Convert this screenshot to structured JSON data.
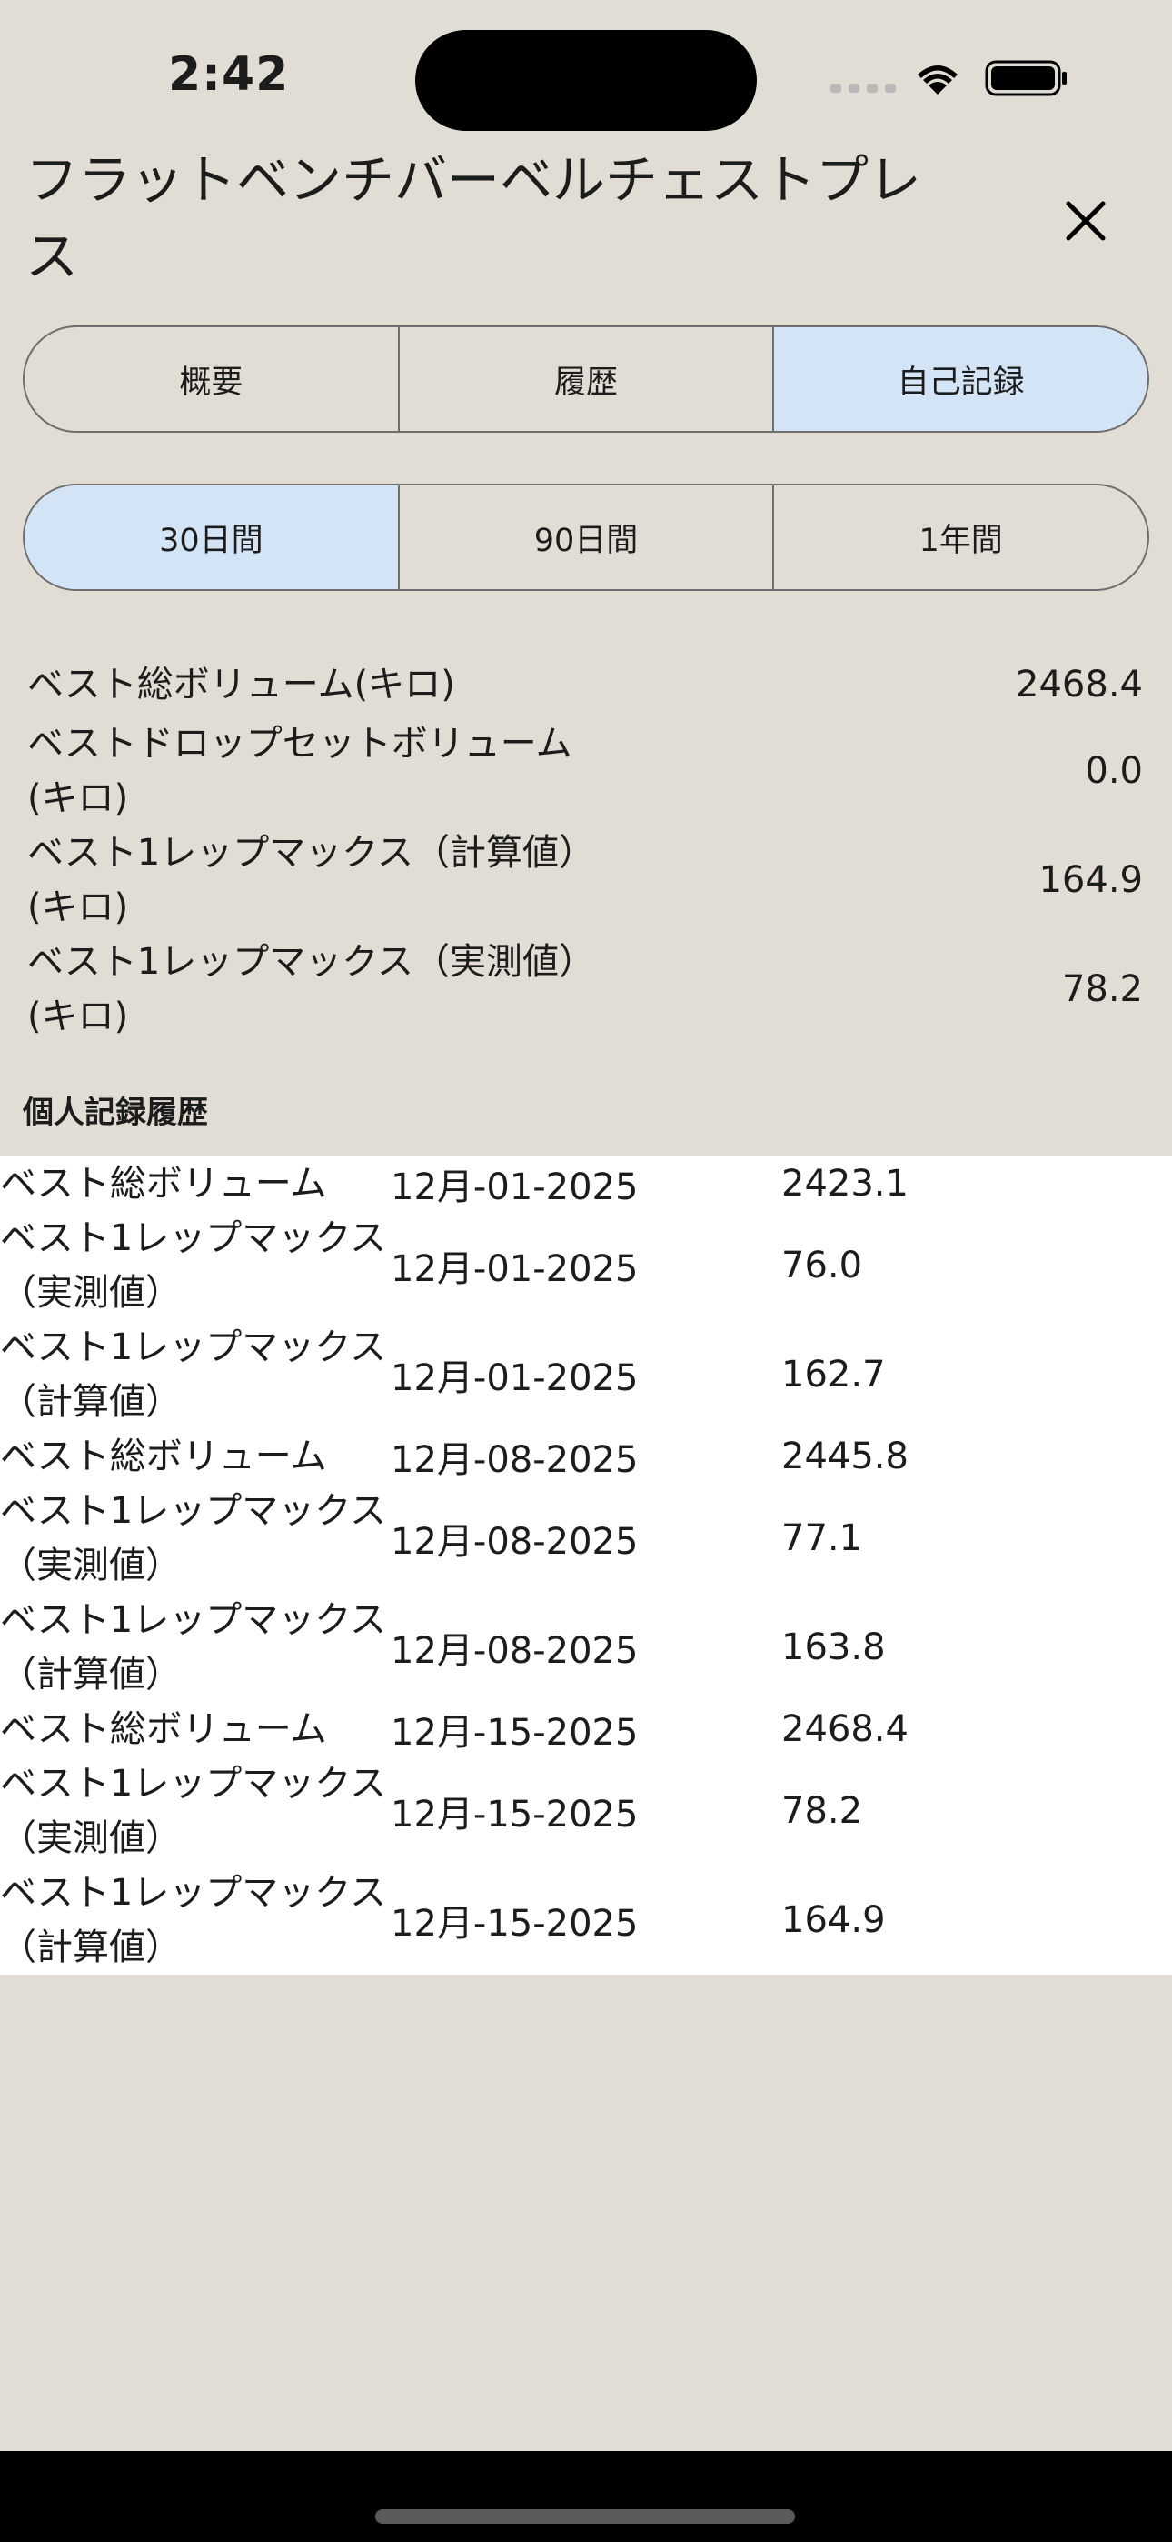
{
  "status_bar": {
    "time": "2:42"
  },
  "header": {
    "title": "フラットベンチバーベルチェストプレス"
  },
  "tabs": [
    {
      "label": "概要",
      "selected": false
    },
    {
      "label": "履歴",
      "selected": false
    },
    {
      "label": "自己記録",
      "selected": true
    }
  ],
  "ranges": [
    {
      "label": "30日間",
      "selected": true
    },
    {
      "label": "90日間",
      "selected": false
    },
    {
      "label": "1年間",
      "selected": false
    }
  ],
  "summary": [
    {
      "label": "ベスト総ボリューム(キロ)",
      "value": "2468.4"
    },
    {
      "label": "ベストドロップセットボリューム(キロ)",
      "value": "0.0"
    },
    {
      "label": "ベスト1レップマックス（計算値）(キロ)",
      "value": "164.9"
    },
    {
      "label": "ベスト1レップマックス（実測値）(キロ)",
      "value": "78.2"
    }
  ],
  "history_title": "個人記録履歴",
  "history": [
    {
      "type": "ベスト総ボリューム",
      "date": "12月-01-2025",
      "value": "2423.1"
    },
    {
      "type": "ベスト1レップマックス（実測値）",
      "date": "12月-01-2025",
      "value": "76.0"
    },
    {
      "type": "ベスト1レップマックス（計算値）",
      "date": "12月-01-2025",
      "value": "162.7"
    },
    {
      "type": "ベスト総ボリューム",
      "date": "12月-08-2025",
      "value": "2445.8"
    },
    {
      "type": "ベスト1レップマックス（実測値）",
      "date": "12月-08-2025",
      "value": "77.1"
    },
    {
      "type": "ベスト1レップマックス（計算値）",
      "date": "12月-08-2025",
      "value": "163.8"
    },
    {
      "type": "ベスト総ボリューム",
      "date": "12月-15-2025",
      "value": "2468.4"
    },
    {
      "type": "ベスト1レップマックス（実測値）",
      "date": "12月-15-2025",
      "value": "78.2"
    },
    {
      "type": "ベスト1レップマックス（計算値）",
      "date": "12月-15-2025",
      "value": "164.9"
    }
  ],
  "colors": {
    "background": "#e1ddd4",
    "selected_segment": "#d4e4f7",
    "history_background": "#ffffff"
  }
}
